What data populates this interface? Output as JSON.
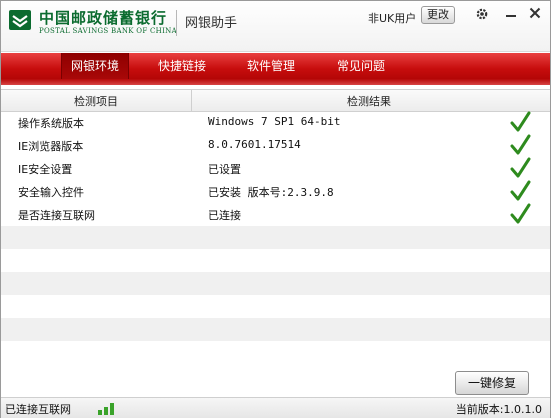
{
  "window": {
    "bank_name_cn": "中国邮政储蓄银行",
    "bank_name_en": "POSTAL SAVINGS BANK OF CHINA",
    "app_title": "网银助手",
    "user_label": "非UK用户",
    "change_button": "更改",
    "icons": [
      "gear-icon",
      "minimize-icon",
      "close-icon"
    ]
  },
  "nav": {
    "tabs": [
      {
        "label": "网银环境",
        "active": true
      },
      {
        "label": "快捷链接",
        "active": false
      },
      {
        "label": "软件管理",
        "active": false
      },
      {
        "label": "常见问题",
        "active": false
      }
    ]
  },
  "table": {
    "headers": [
      "检测项目",
      "检测结果"
    ],
    "rows": [
      {
        "item": "操作系统版本",
        "result": "Windows 7 SP1 64-bit",
        "status": "ok"
      },
      {
        "item": "IE浏览器版本",
        "result": "8.0.7601.17514",
        "status": "ok"
      },
      {
        "item": "IE安全设置",
        "result": "已设置",
        "status": "ok"
      },
      {
        "item": "安全输入控件",
        "result": "已安装  版本号:2.3.9.8",
        "status": "ok"
      },
      {
        "item": "是否连接互联网",
        "result": "已连接",
        "status": "ok"
      }
    ]
  },
  "actions": {
    "repair_button": "一键修复"
  },
  "status": {
    "connection": "已连接互联网",
    "version": "当前版本:1.0.1.0"
  },
  "colors": {
    "brand_green": "#0b6b2f",
    "nav_red": "#c70d0d",
    "check_green": "#2e8b1e"
  }
}
